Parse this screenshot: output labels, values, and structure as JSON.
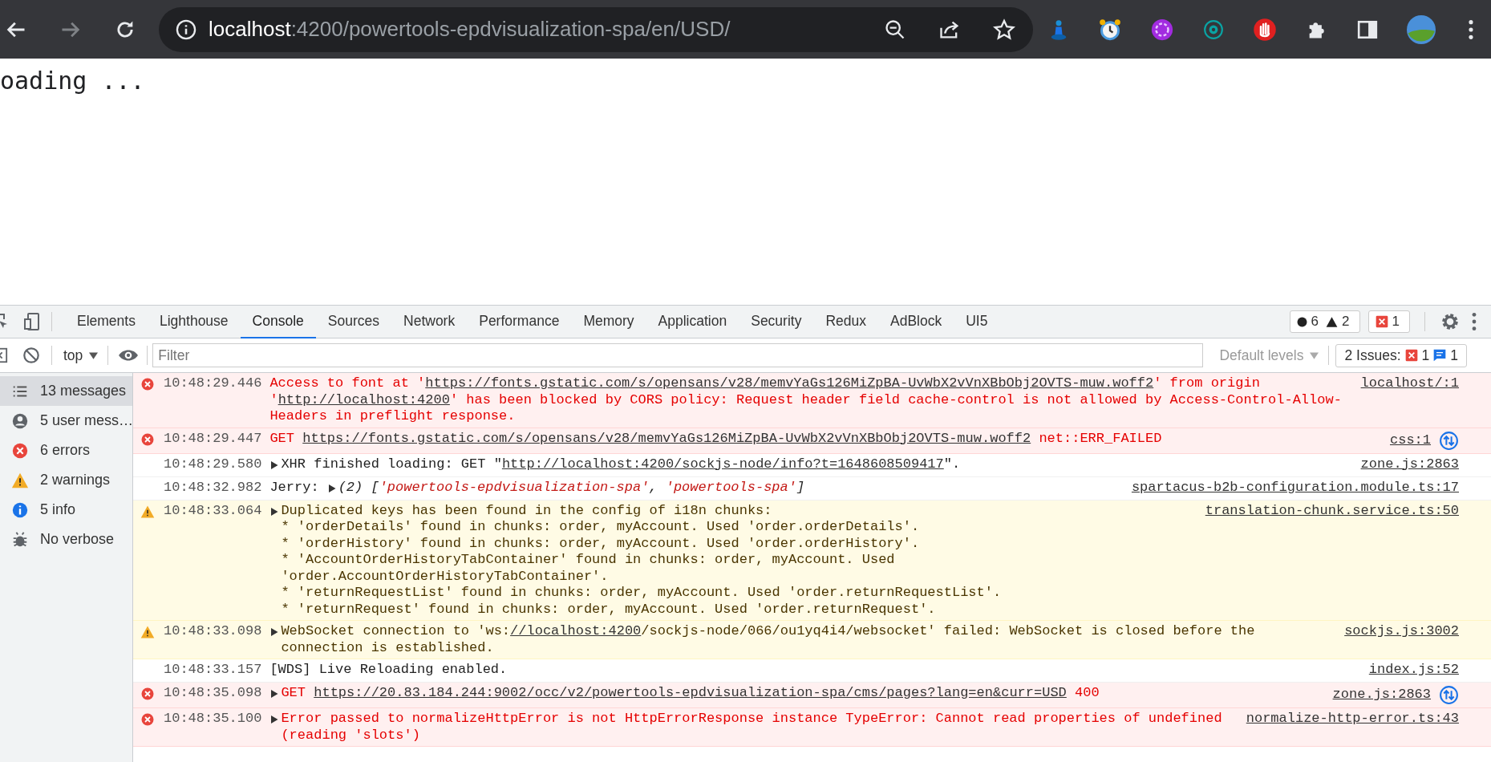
{
  "browser": {
    "url_host": "localhost",
    "url_rest": ":4200/powertools-epdvisualization-spa/en/USD/"
  },
  "page": {
    "text": "oading ..."
  },
  "devtools": {
    "tabs": [
      {
        "label": "Elements",
        "selected": false
      },
      {
        "label": "Lighthouse",
        "selected": false
      },
      {
        "label": "Console",
        "selected": true
      },
      {
        "label": "Sources",
        "selected": false
      },
      {
        "label": "Network",
        "selected": false
      },
      {
        "label": "Performance",
        "selected": false
      },
      {
        "label": "Memory",
        "selected": false
      },
      {
        "label": "Application",
        "selected": false
      },
      {
        "label": "Security",
        "selected": false
      },
      {
        "label": "Redux",
        "selected": false
      },
      {
        "label": "AdBlock",
        "selected": false
      },
      {
        "label": "UI5",
        "selected": false
      }
    ],
    "error_count": "6",
    "warning_count": "2",
    "issue_count": "1"
  },
  "toolbar": {
    "context": "top",
    "filter_placeholder": "Filter",
    "levels": "Default levels",
    "issues_label": "2 Issues:",
    "issues_errors": "1",
    "issues_info": "1"
  },
  "sidebar": [
    {
      "kind": "all",
      "label": "13 messages",
      "selected": true
    },
    {
      "kind": "user",
      "label": "5 user mess…",
      "selected": false
    },
    {
      "kind": "error",
      "label": "6 errors",
      "selected": false
    },
    {
      "kind": "warning",
      "label": "2 warnings",
      "selected": false
    },
    {
      "kind": "info",
      "label": "5 info",
      "selected": false
    },
    {
      "kind": "verbose",
      "label": "No verbose",
      "selected": false
    }
  ],
  "messages": [
    {
      "kind": "error",
      "time": "10:48:29.446",
      "parts": [
        {
          "kind": "text",
          "text": "Access to font at '"
        },
        {
          "kind": "link",
          "text": "https://fonts.gstatic.com/s/opensans/v28/memvYaGs126MiZpBA-UvWbX2vVnXBbObj2OVTS-muw.woff2"
        },
        {
          "kind": "text",
          "text": "' from origin '"
        },
        {
          "kind": "link",
          "text": "http://localhost:4200"
        },
        {
          "kind": "text",
          "text": "' has been blocked by CORS policy: Request header field cache-control is not allowed by Access-Control-Allow-Headers in preflight response."
        }
      ],
      "source": "localhost/:1",
      "network": false
    },
    {
      "kind": "error",
      "time": "10:48:29.447",
      "parts": [
        {
          "kind": "text",
          "text": "GET "
        },
        {
          "kind": "link",
          "text": "https://fonts.gstatic.com/s/opensans/v28/memvYaGs126MiZpBA-UvWbX2vVnXBbObj2OVTS-muw.woff2"
        },
        {
          "kind": "text",
          "text": " net::ERR_FAILED"
        }
      ],
      "source": "css:1",
      "network": true
    },
    {
      "kind": "log",
      "time": "10:48:29.580",
      "expanded": false,
      "parts": [
        {
          "kind": "text",
          "text": "XHR finished loading: GET \""
        },
        {
          "kind": "link",
          "text": "http://localhost:4200/sockjs-node/info?t=1648608509417"
        },
        {
          "kind": "text",
          "text": "\"."
        }
      ],
      "source": "zone.js:2863",
      "network": false
    },
    {
      "kind": "log",
      "time": "10:48:32.982",
      "prefix": "Jerry:",
      "expanded": false,
      "parts": [
        {
          "kind": "italic",
          "text": "(2) ["
        },
        {
          "kind": "string",
          "text": "'powertools-epdvisualization-spa'"
        },
        {
          "kind": "italic",
          "text": ", "
        },
        {
          "kind": "string",
          "text": "'powertools-spa'"
        },
        {
          "kind": "italic",
          "text": "]"
        }
      ],
      "source": "spartacus-b2b-configuration.module.ts:17",
      "network": false
    },
    {
      "kind": "warning",
      "time": "10:48:33.064",
      "expanded": false,
      "parts": [
        {
          "kind": "text",
          "text": "Duplicated keys has been found in the config of i18n chunks:\n* 'orderDetails' found in chunks: order, myAccount. Used 'order.orderDetails'.\n* 'orderHistory' found in chunks: order, myAccount. Used 'order.orderHistory'.\n* 'AccountOrderHistoryTabContainer' found in chunks: order, myAccount. Used 'order.AccountOrderHistoryTabContainer'.\n* 'returnRequestList' found in chunks: order, myAccount. Used 'order.returnRequestList'.\n* 'returnRequest' found in chunks: order, myAccount. Used 'order.returnRequest'."
        }
      ],
      "source": "translation-chunk.service.ts:50",
      "network": false
    },
    {
      "kind": "warning",
      "time": "10:48:33.098",
      "expanded": false,
      "parts": [
        {
          "kind": "text",
          "text": "WebSocket connection to 'ws:"
        },
        {
          "kind": "link",
          "text": "//localhost:4200"
        },
        {
          "kind": "text",
          "text": "/sockjs-node/066/ou1yq4i4/websocket' failed: WebSocket is closed before the connection is established."
        }
      ],
      "source": "sockjs.js:3002",
      "network": false
    },
    {
      "kind": "log",
      "time": "10:48:33.157",
      "parts": [
        {
          "kind": "text",
          "text": "[WDS] Live Reloading enabled."
        }
      ],
      "source": "index.js:52",
      "network": false
    },
    {
      "kind": "error",
      "time": "10:48:35.098",
      "expanded": false,
      "parts": [
        {
          "kind": "text",
          "text": "GET "
        },
        {
          "kind": "link",
          "text": "https://20.83.184.244:9002/occ/v2/powertools-epdvisualization-spa/cms/pages?lang=en&curr=USD"
        },
        {
          "kind": "text",
          "text": " 400"
        }
      ],
      "source": "zone.js:2863",
      "network": true
    },
    {
      "kind": "error",
      "time": "10:48:35.100",
      "expanded": false,
      "parts": [
        {
          "kind": "text",
          "text": "Error passed to normalizeHttpError is not HttpErrorResponse instance TypeError: Cannot read properties of undefined (reading 'slots')"
        }
      ],
      "source": "normalize-http-error.ts:43",
      "network": false
    }
  ]
}
